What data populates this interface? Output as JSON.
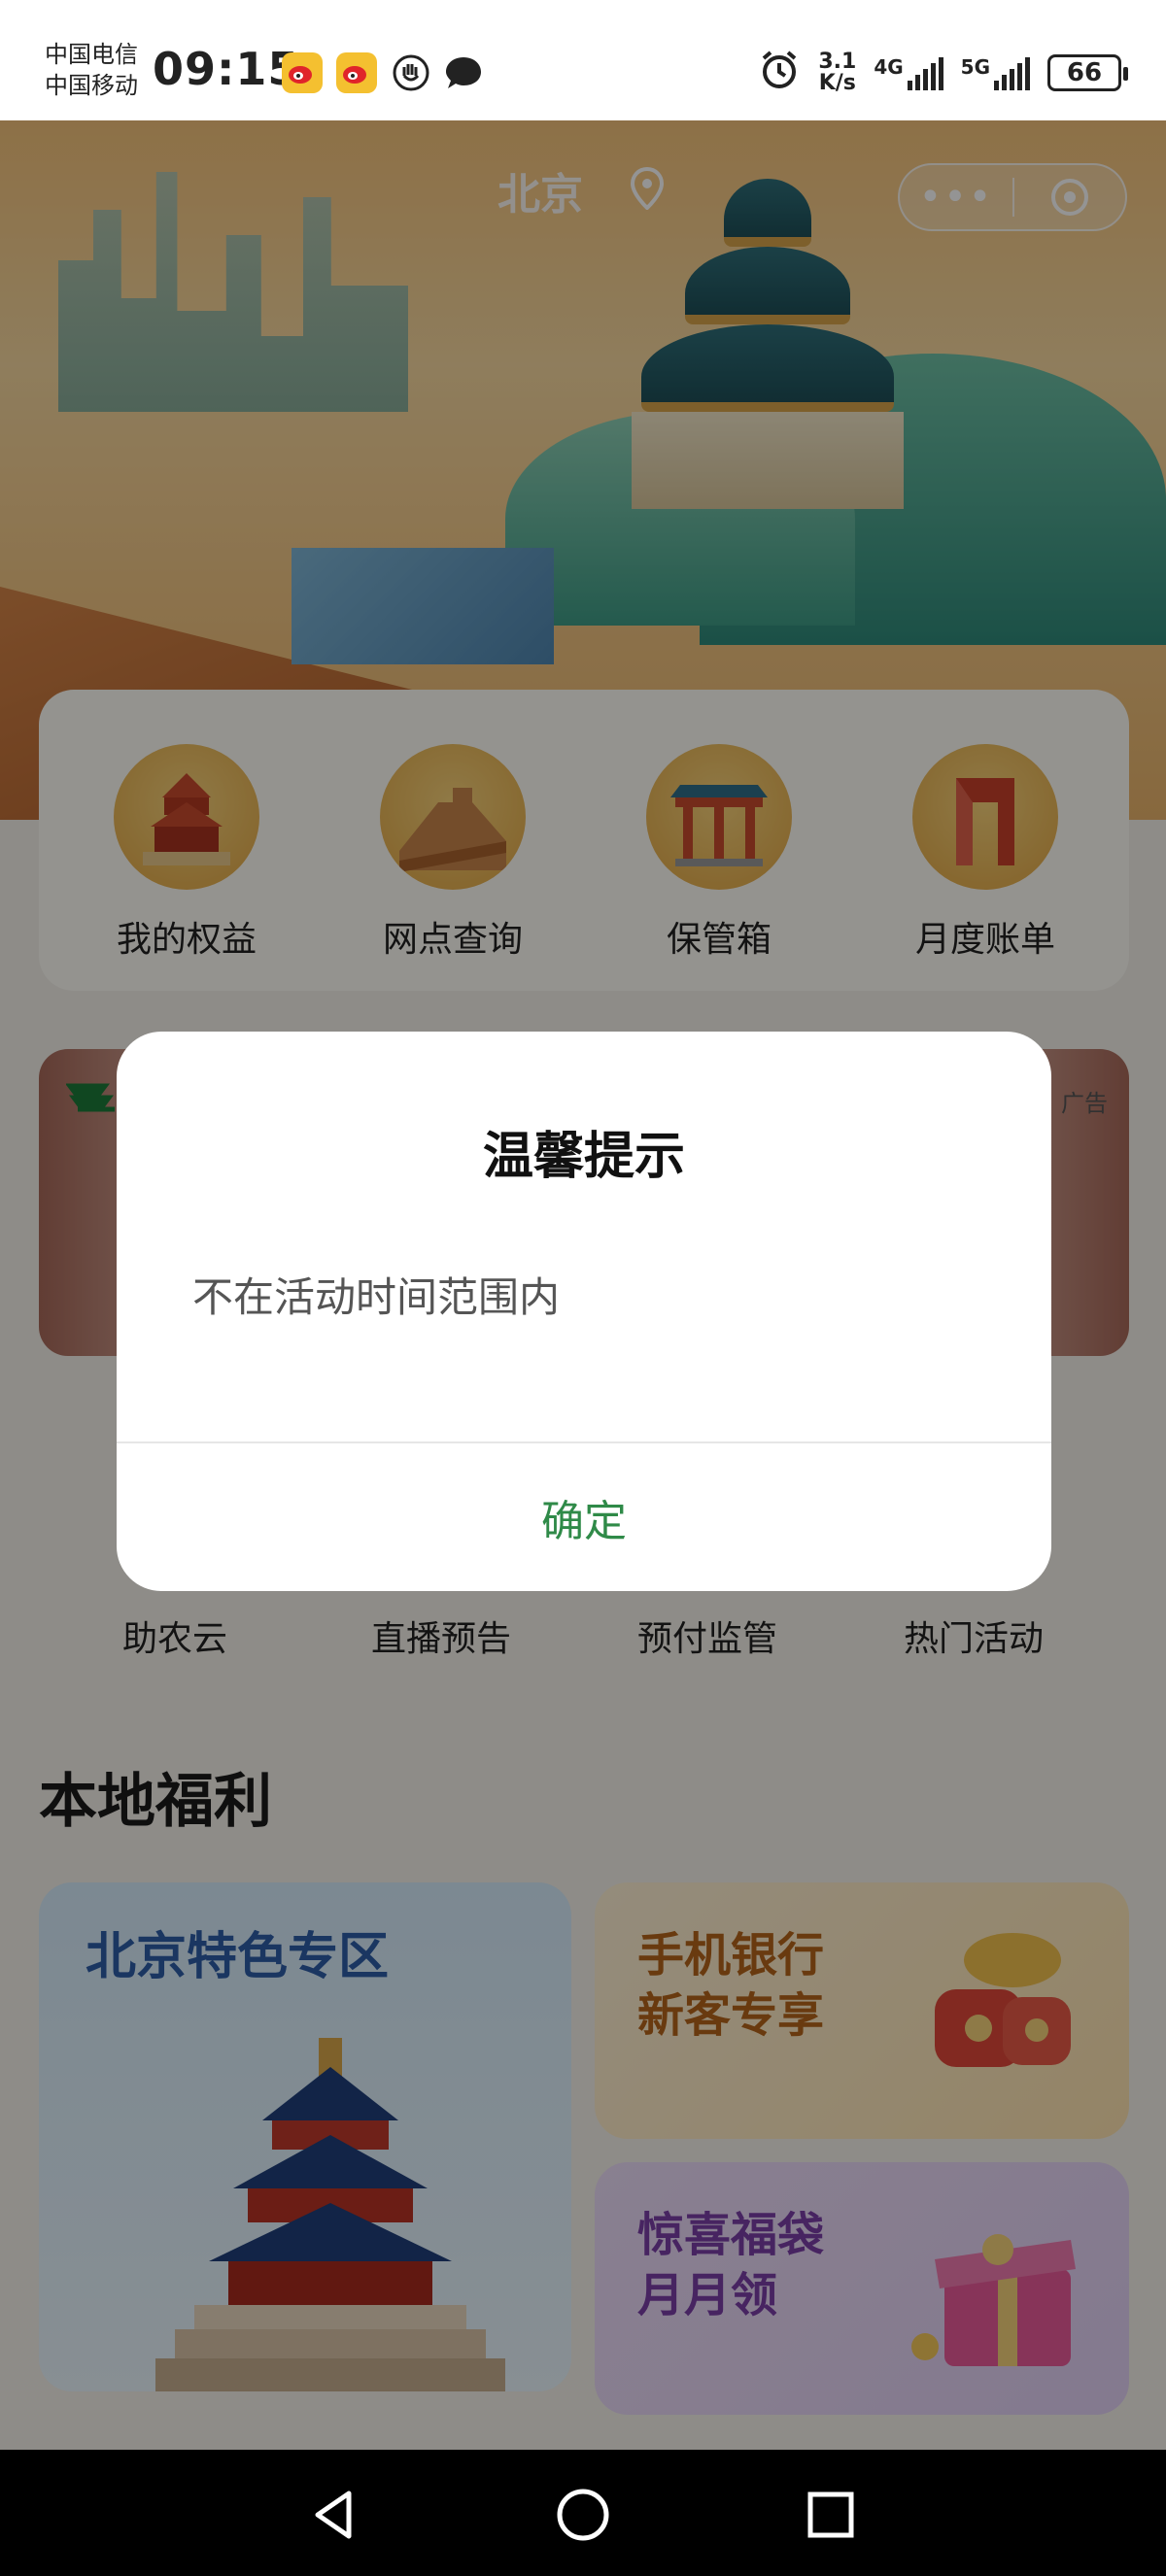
{
  "status_bar": {
    "carrier_1": "中国电信",
    "carrier_2": "中国移动",
    "time": "09:15",
    "speed_value": "3.1",
    "speed_unit": "K/s",
    "net_1": "4G",
    "net_2": "5G",
    "battery": "66",
    "notif_icons": [
      "weibo-icon",
      "weibo-icon",
      "hand-icon",
      "chat-bubble-icon"
    ],
    "right_icons": [
      "alarm-icon",
      "signal-icon",
      "signal-icon",
      "battery-icon"
    ]
  },
  "hero": {
    "city": "北京",
    "capsule": {
      "more_icon": "more-dots-icon",
      "close_icon": "target-icon"
    }
  },
  "quick_entries": [
    {
      "label": "我的权益",
      "icon": "temple-of-heaven-icon"
    },
    {
      "label": "网点查询",
      "icon": "great-wall-icon"
    },
    {
      "label": "保管箱",
      "icon": "archway-icon"
    },
    {
      "label": "月度账单",
      "icon": "gate-icon"
    }
  ],
  "banner": {
    "ad_label": "广告"
  },
  "grid_row": [
    {
      "label": "助农云"
    },
    {
      "label": "直播预告"
    },
    {
      "label": "预付监管"
    },
    {
      "label": "热门活动"
    }
  ],
  "local_benefits": {
    "title": "本地福利",
    "cards": [
      {
        "text": "北京特色专区"
      },
      {
        "line1": "手机银行",
        "line2": "新客专享"
      },
      {
        "line1": "惊喜福袋",
        "line2": "月月领"
      }
    ]
  },
  "dialog": {
    "title": "温馨提示",
    "message": "不在活动时间范围内",
    "confirm_label": "确定"
  },
  "nav": {
    "icons": [
      "back-icon",
      "home-icon",
      "recents-icon"
    ]
  },
  "colors": {
    "accent": "#2f8a48",
    "overlay": "rgba(0,0,0,0.42)"
  }
}
